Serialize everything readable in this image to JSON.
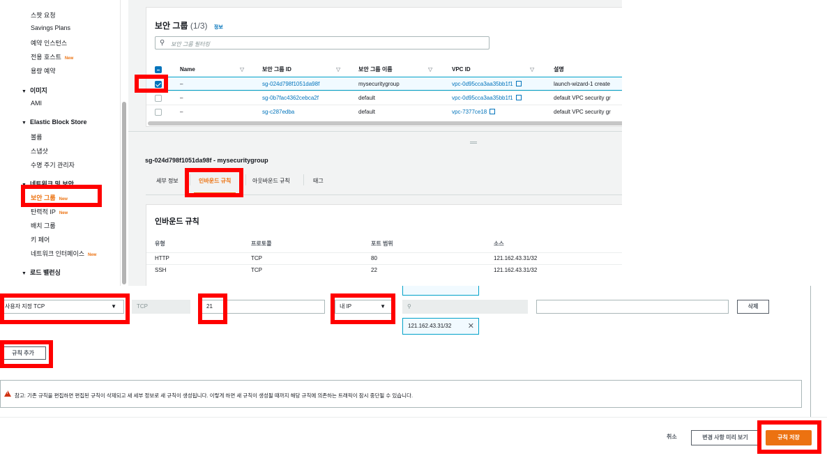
{
  "sidebar": {
    "items": [
      {
        "label": "스팟 요청"
      },
      {
        "label": "Savings Plans"
      },
      {
        "label": "예약 인스턴스"
      },
      {
        "label": "전용 호스트",
        "badge": "New"
      },
      {
        "label": "용량 예약"
      }
    ],
    "sections": [
      {
        "label": "이미지",
        "items": [
          {
            "label": "AMI"
          }
        ]
      },
      {
        "label": "Elastic Block Store",
        "items": [
          {
            "label": "볼륨"
          },
          {
            "label": "스냅샷"
          },
          {
            "label": "수명 주기 관리자"
          }
        ]
      },
      {
        "label": "네트워크 및 보안",
        "items": [
          {
            "label": "보안 그룹",
            "badge": "New",
            "active": true
          },
          {
            "label": "탄력적 IP",
            "badge": "New"
          },
          {
            "label": "배치 그룹"
          },
          {
            "label": "키 페어"
          },
          {
            "label": "네트워크 인터페이스",
            "badge": "New"
          }
        ]
      },
      {
        "label": "로드 밸런싱",
        "items": []
      }
    ]
  },
  "security_groups": {
    "title": "보안 그룹",
    "count": "(1/3)",
    "info": "정보",
    "filter_placeholder": "보안 그룹 필터링",
    "columns": [
      "Name",
      "보안 그룹 ID",
      "보안 그룹 이름",
      "VPC ID",
      "설명"
    ],
    "rows": [
      {
        "name": "–",
        "id": "sg-024d798f1051da98f",
        "group_name": "mysecuritygroup",
        "vpc": "vpc-0d95cca3aa35bb1f1",
        "desc": "launch-wizard-1 create",
        "selected": true
      },
      {
        "name": "–",
        "id": "sg-0b7fac4362cebca2f",
        "group_name": "default",
        "vpc": "vpc-0d95cca3aa35bb1f1",
        "desc": "default VPC security gr",
        "selected": false
      },
      {
        "name": "–",
        "id": "sg-c287edba",
        "group_name": "default",
        "vpc": "vpc-7377ce18",
        "desc": "default VPC security gr",
        "selected": false
      }
    ]
  },
  "detail": {
    "title": "sg-024d798f1051da98f - mysecuritygroup",
    "tabs": [
      {
        "label": "세부 정보",
        "active": false
      },
      {
        "label": "인바운드 규칙",
        "active": true
      },
      {
        "label": "아웃바운드 규칙",
        "active": false
      },
      {
        "label": "태그",
        "active": false
      }
    ],
    "inbound": {
      "title": "인바운드 규칙",
      "columns": [
        "유형",
        "프로토콜",
        "포트 범위",
        "소스"
      ],
      "rows": [
        {
          "type": "HTTP",
          "protocol": "TCP",
          "port": "80",
          "source": "121.162.43.31/32"
        },
        {
          "type": "SSH",
          "protocol": "TCP",
          "port": "22",
          "source": "121.162.43.31/32"
        }
      ]
    }
  },
  "rule_form": {
    "type_value": "사용자 지정 TCP",
    "protocol_value": "TCP",
    "port_value": "21",
    "source_value": "내 IP",
    "cidr_token": "121.162.43.31/32",
    "delete_label": "삭제",
    "add_rule_label": "규칙 추가"
  },
  "notice": {
    "text": "참고: 기존 규칙을 편집하면 편집된 규칙이 삭제되고 새 세부 정보로 새 규칙이 생성됩니다. 이렇게 하면 새 규칙이 생성될 때까지 해당 규칙에 의존하는 트래픽이 잠시 중단될 수 있습니다."
  },
  "footer": {
    "cancel_label": "취소",
    "preview_label": "변경 사항 미리 보기",
    "save_label": "규칙 저장"
  },
  "colors": {
    "accent": "#ec7211",
    "link": "#0073bb",
    "highlight": "#ff0000"
  }
}
